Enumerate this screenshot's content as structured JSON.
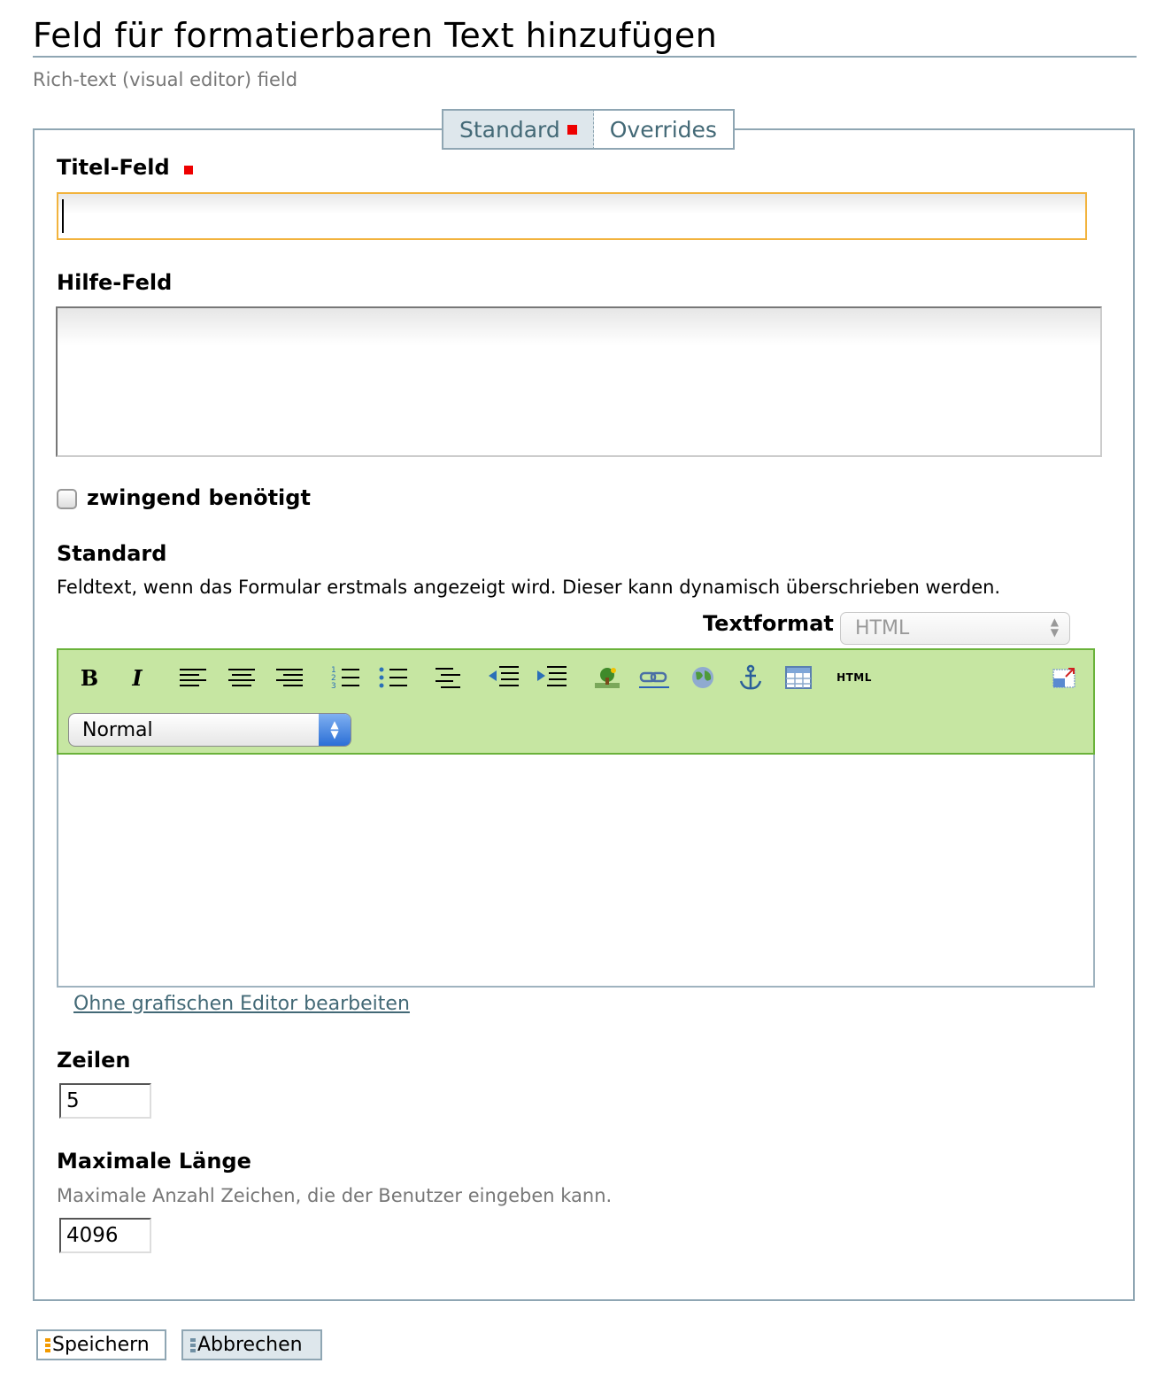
{
  "header": {
    "title": "Feld für formatierbaren Text hinzufügen",
    "subtitle": "Rich-text (visual editor) field"
  },
  "tabs": [
    {
      "label": "Standard",
      "selected": true,
      "required_marker": true
    },
    {
      "label": "Overrides",
      "selected": false
    }
  ],
  "form": {
    "title_field": {
      "label": "Titel-Feld",
      "required": true,
      "value": ""
    },
    "help_field": {
      "label": "Hilfe-Feld",
      "value": ""
    },
    "required_checkbox": {
      "label": "zwingend benötigt",
      "checked": false
    },
    "default": {
      "label": "Standard",
      "description": "Feldtext, wenn das Formular erstmals angezeigt wird. Dieser kann dynamisch überschrieben werden.",
      "textformat_label": "Textformat",
      "textformat_value": "HTML",
      "toolbar": {
        "buttons": [
          "bold",
          "italic",
          "align-left",
          "align-center",
          "align-right",
          "ordered-list",
          "unordered-list",
          "definition-list",
          "outdent",
          "indent",
          "image",
          "link",
          "external-link",
          "anchor",
          "table",
          "html-source",
          "fullscreen"
        ],
        "bold_glyph": "B",
        "italic_glyph": "I",
        "html_label": "HTML",
        "style_select_value": "Normal"
      },
      "editor_content": "",
      "no_editor_link": "Ohne grafischen Editor bearbeiten"
    },
    "rows": {
      "label": "Zeilen",
      "value": "5"
    },
    "max_length": {
      "label": "Maximale Länge",
      "help": "Maximale Anzahl Zeichen, die der Benutzer eingeben kann.",
      "value": "4096"
    }
  },
  "footer": {
    "save_label": "Speichern",
    "cancel_label": "Abbrechen"
  },
  "colors": {
    "accent_border": "#8fa6b3",
    "focus_border": "#f2b33d",
    "required": "#ee0000",
    "toolbar_bg": "#c6e6a2",
    "link": "#436976"
  }
}
